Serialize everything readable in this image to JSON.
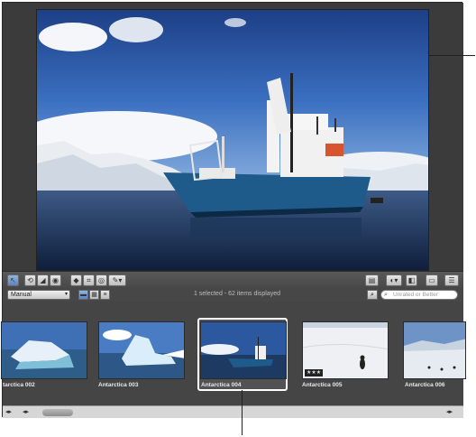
{
  "viewer": {
    "photo_name": "Antarctica 004"
  },
  "toolbar": {
    "left_tools": [
      "arrow-tool",
      "rotate-tool",
      "straighten-tool",
      "stamp-tool",
      "lift-tool",
      "crop-tool",
      "redeye-tool",
      "brush-tool"
    ],
    "right_tools": [
      "inspector-tool",
      "adjustments-tool",
      "metadata-tool",
      "fullscreen-tool",
      "layout-tool"
    ]
  },
  "browser_bar": {
    "sort_value": "Manual",
    "status": "1 selected - 62 items displayed",
    "search_placeholder": "Unrated or Better"
  },
  "thumbnails": [
    {
      "label": "tarctica 002",
      "rating": ""
    },
    {
      "label": "Antarctica 003",
      "rating": ""
    },
    {
      "label": "Antarctica 004",
      "rating": "",
      "selected": true
    },
    {
      "label": "Antarctica 005",
      "rating": "★★★"
    },
    {
      "label": "Antarctica 006",
      "rating": ""
    }
  ],
  "colors": {
    "background": "#3e3e3e",
    "selection": "#ffffff",
    "accent": "#5c86c0"
  }
}
